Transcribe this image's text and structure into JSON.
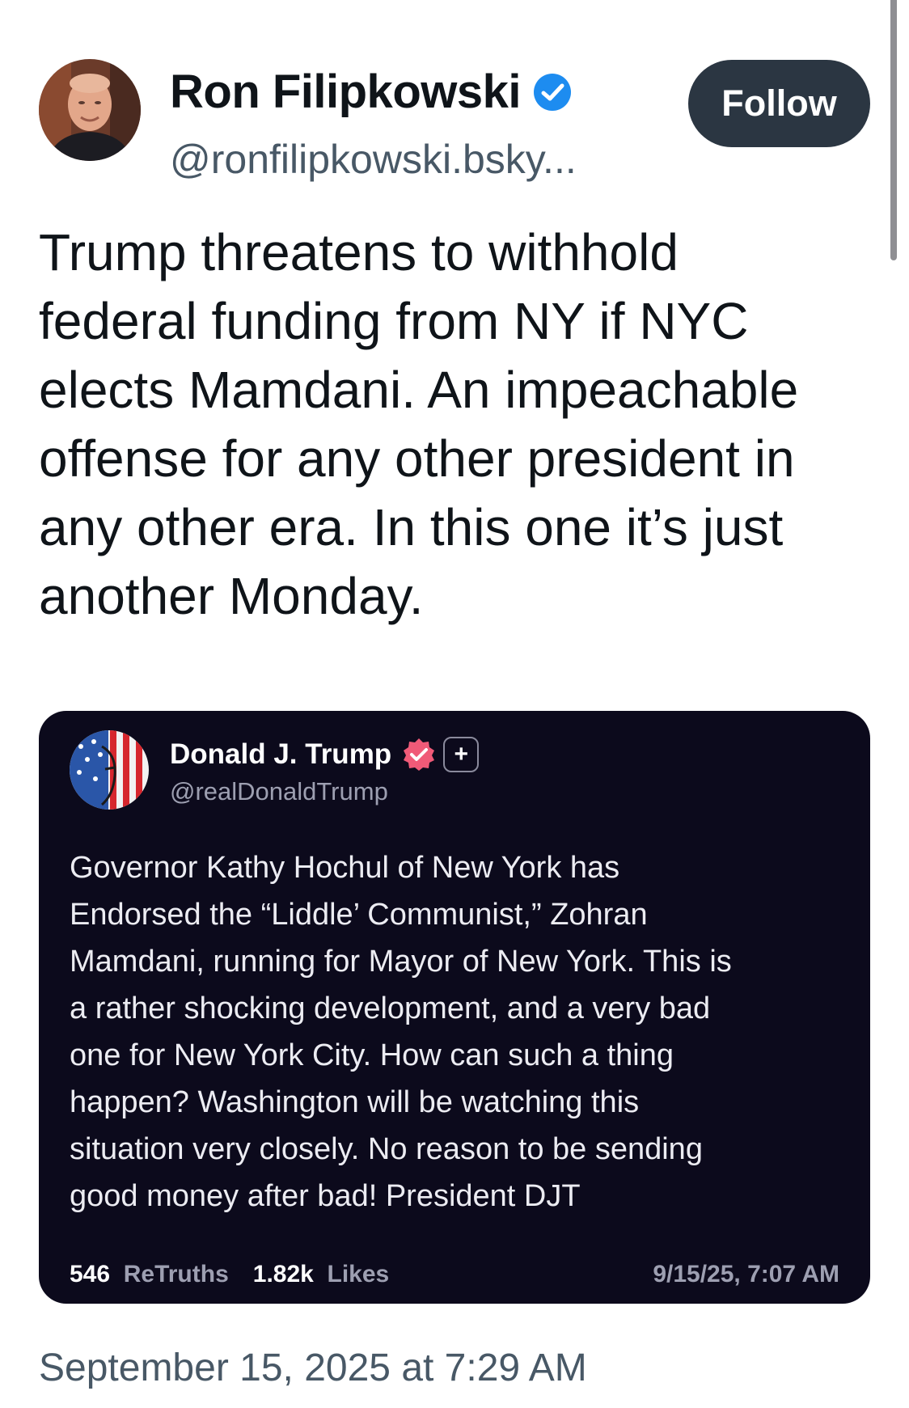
{
  "author": {
    "name": "Ron Filipkowski",
    "handle": "@ronfilipkowski.bsky...",
    "verified_color": "#1d8cf0"
  },
  "follow_label": "Follow",
  "post_lines": [
    "Trump threatens to withhold",
    "federal funding from NY if NYC",
    "elects Mamdani. An impeachable",
    "offense for any other president in",
    "any other era. In this one it’s just",
    "another Monday."
  ],
  "quote": {
    "name": "Donald J. Trump",
    "handle": "@realDonaldTrump",
    "badge_color": "#f05a78",
    "plus_label": "+",
    "lines": [
      "Governor Kathy Hochul of New York has",
      "Endorsed the “Liddle’ Communist,” Zohran",
      "Mamdani, running for Mayor of New York. This is",
      "a rather shocking development, and a very bad",
      "one for New York City. How can such a thing",
      "happen? Washington will be watching this",
      "situation very closely. No reason to be sending",
      "good money after bad! President DJT"
    ],
    "retruths_count": "546",
    "retruths_label": "ReTruths",
    "likes_count": "1.82k",
    "likes_label": "Likes",
    "time": "9/15/25, 7:07 AM"
  },
  "timestamp": "September 15, 2025 at 7:29 AM"
}
